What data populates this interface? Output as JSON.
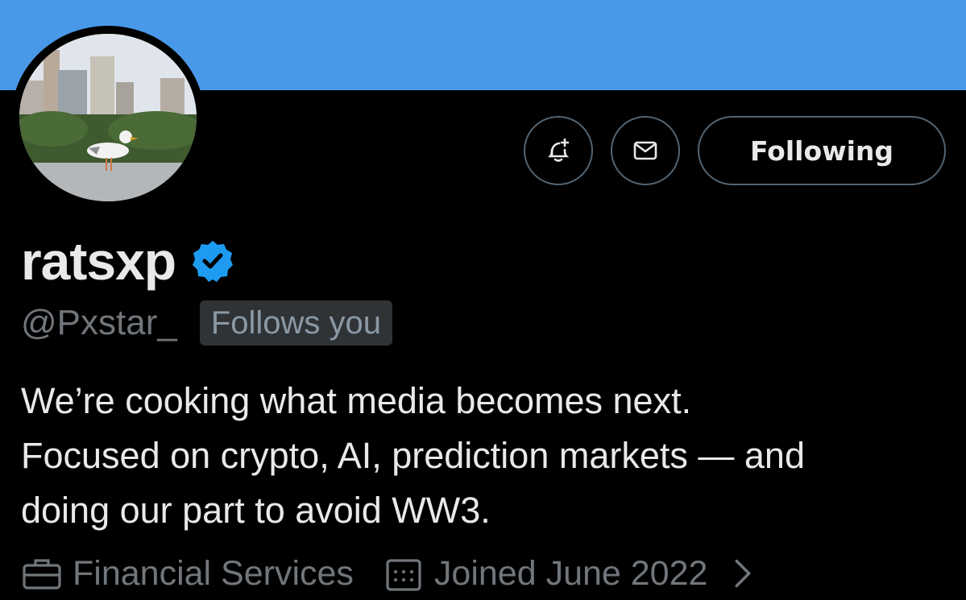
{
  "profile": {
    "display_name": "ratsxp",
    "handle": "@Pxstar_",
    "follows_you": "Follows you",
    "verified": true,
    "bio_lines": [
      "We’re cooking what media becomes next.",
      "Focused on crypto, AI, prediction markets — and",
      "doing our part to avoid WW3."
    ],
    "category": "Financial Services",
    "joined": "Joined June 2022"
  },
  "actions": {
    "following_label": "Following"
  },
  "icons": {
    "notify": "bell-plus-icon",
    "message": "envelope-icon",
    "verified": "verified-badge-icon",
    "category": "briefcase-icon",
    "joined": "calendar-icon",
    "more": "chevron-right-icon"
  },
  "colors": {
    "banner": "#4a99e9",
    "background": "#000000",
    "verified_blue": "#1d9bf0",
    "muted_text": "#71767b"
  }
}
